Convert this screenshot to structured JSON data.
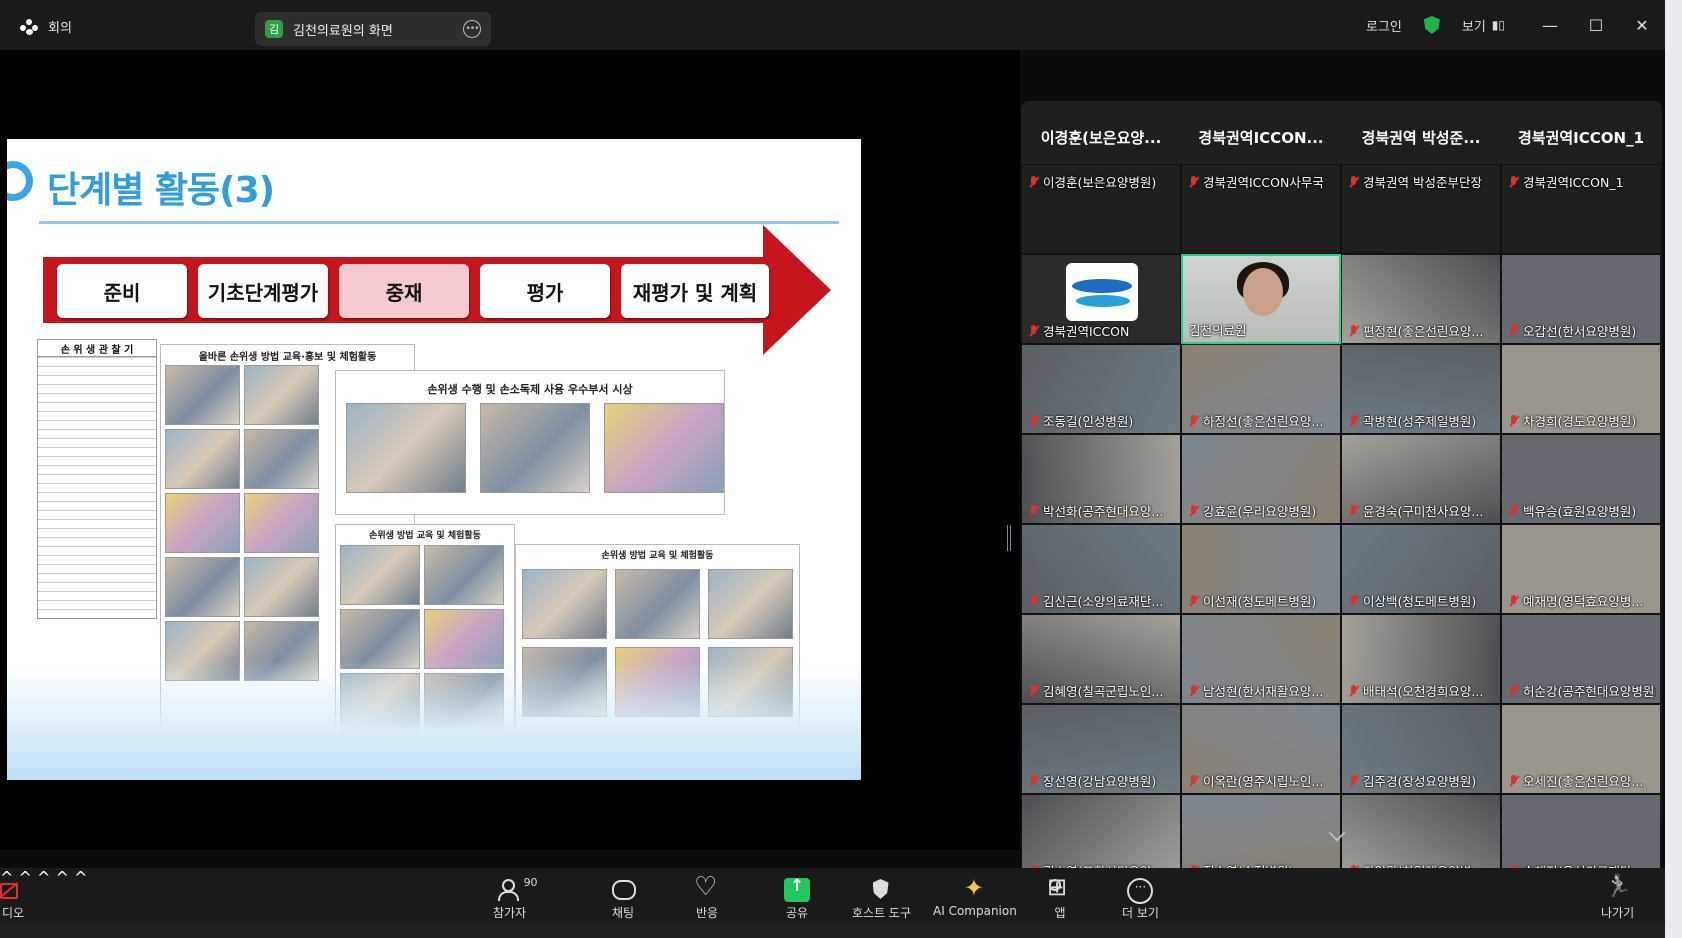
{
  "titlebar": {
    "meeting_label": "회의",
    "share_badge": "김",
    "share_label": "김천의료원의 화면",
    "login_label": "로그인",
    "view_label": "보기"
  },
  "slide": {
    "title": "단계별 활동(3)",
    "steps": [
      "준비",
      "기초단계평가",
      "중재",
      "평가",
      "재평가 및 계획"
    ],
    "active_step": "중재",
    "form_title": "손 위 생 관 찰 기",
    "panel1_title": "올바른 손위생 방법 교육·홍보 및 체험활동",
    "panel2_title": "손위생 수행 및 손소독제 사용 우수부서 시상",
    "panel3_title": "손위생 방법 교육 및 체험활동",
    "panel4_title": "손위생 방법 교육 및 체험활동"
  },
  "gallery": {
    "headers": [
      "이경훈(보은요양...",
      "경북권역ICCON...",
      "경북권역 박성준...",
      "경북권역ICCON_1"
    ],
    "tiles": [
      {
        "name": "이경훈(보은요양병원)",
        "muted": true,
        "kind": "blank"
      },
      {
        "name": "경북권역ICCON사무국",
        "muted": true,
        "kind": "blank"
      },
      {
        "name": "경북권역 박성준부단장",
        "muted": true,
        "kind": "blank"
      },
      {
        "name": "경북권역ICCON_1",
        "muted": true,
        "kind": "blank"
      },
      {
        "name": "경북권역ICCON",
        "muted": true,
        "kind": "logo"
      },
      {
        "name": "김천의료원",
        "muted": false,
        "kind": "speaker"
      },
      {
        "name": "편정현(좋은선린요양...",
        "muted": true,
        "kind": "video"
      },
      {
        "name": "오갑선(한서요양병원)",
        "muted": true,
        "kind": "video"
      },
      {
        "name": "조동길(인성병원)",
        "muted": true,
        "kind": "video"
      },
      {
        "name": "하정선(좋은선린요양...",
        "muted": true,
        "kind": "video"
      },
      {
        "name": "곽병현(성주제일병원)",
        "muted": true,
        "kind": "video"
      },
      {
        "name": "차경희(경도요양병원)",
        "muted": true,
        "kind": "video"
      },
      {
        "name": "박선화(공주현대요양...",
        "muted": true,
        "kind": "video"
      },
      {
        "name": "강효윤(우리요양병원)",
        "muted": true,
        "kind": "video"
      },
      {
        "name": "윤경숙(구미천사요양...",
        "muted": true,
        "kind": "video"
      },
      {
        "name": "백유승(효원요양병원)",
        "muted": true,
        "kind": "video"
      },
      {
        "name": "김신근(소양의료재단...",
        "muted": true,
        "kind": "video"
      },
      {
        "name": "이선재(청도메트병원)",
        "muted": true,
        "kind": "video"
      },
      {
        "name": "이상백(청도메트병원)",
        "muted": true,
        "kind": "video"
      },
      {
        "name": "예재명(영덕효요양병...",
        "muted": true,
        "kind": "video"
      },
      {
        "name": "김혜영(칠곡군립노인...",
        "muted": true,
        "kind": "video"
      },
      {
        "name": "남성현(한서재활요양...",
        "muted": true,
        "kind": "video"
      },
      {
        "name": "배태석(오천경희요양...",
        "muted": true,
        "kind": "video"
      },
      {
        "name": "허순강(공주현대요양병원)",
        "muted": true,
        "kind": "video"
      },
      {
        "name": "장선영(강남요양병원)",
        "muted": true,
        "kind": "video"
      },
      {
        "name": "이옥란(영주시립노인...",
        "muted": true,
        "kind": "video"
      },
      {
        "name": "김주경(장성요양병원)",
        "muted": true,
        "kind": "video"
      },
      {
        "name": "오세진(좋은선린요양...",
        "muted": true,
        "kind": "video"
      },
      {
        "name": "권소영(포항시티요양...",
        "muted": true,
        "kind": "video"
      },
      {
        "name": "정순영(순정병원)",
        "muted": true,
        "kind": "video"
      },
      {
        "name": "장익완(하일렌요양병...",
        "muted": true,
        "kind": "video"
      },
      {
        "name": "손해진(우석의료재단...",
        "muted": true,
        "kind": "video"
      }
    ]
  },
  "toolbar": {
    "video_label": "디오",
    "participants_label": "참가자",
    "participants_count": "90",
    "chat_label": "채팅",
    "reactions_label": "반응",
    "share_label": "공유",
    "host_tools_label": "호스트 도구",
    "ai_label": "AI Companion",
    "apps_label": "앱",
    "more_label": "더 보기",
    "leave_label": "나가기"
  },
  "colors": {
    "accent_green": "#22c55e",
    "muted_red": "#e02f2f",
    "slide_red": "#c4161c",
    "slide_blue": "#2f9fdc"
  }
}
